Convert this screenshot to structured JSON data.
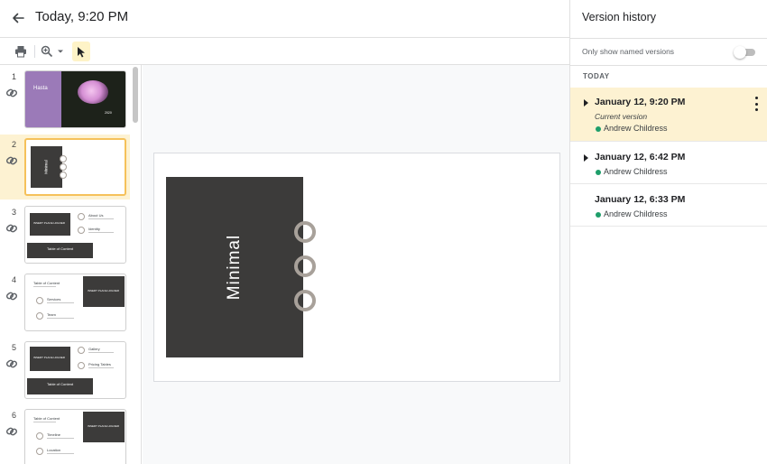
{
  "header": {
    "title": "Today, 9:20 PM"
  },
  "toolbar": {
    "icons": [
      "print-icon",
      "zoom-icon",
      "chevron-down-icon",
      "cursor-icon"
    ]
  },
  "filmstrip": {
    "slides": [
      {
        "number": "1",
        "title": "Hasta",
        "year": "2020"
      },
      {
        "number": "2",
        "title": "Minimal"
      },
      {
        "number": "3",
        "ph": "INSERT PLACE HOLDER",
        "text1": "About Us",
        "text2": "Identity",
        "toc": "Table of Content"
      },
      {
        "number": "4",
        "title": "Table of Content",
        "ph": "INSERT PLACE HOLDER",
        "text1": "Services",
        "text2": "Team"
      },
      {
        "number": "5",
        "ph": "INSERT PLACE HOLDER",
        "text1": "Gallery",
        "text2": "Pricing Tables",
        "toc": "Table of Content"
      },
      {
        "number": "6",
        "title": "Table of Content",
        "ph": "INSERT PLACE HOLDER",
        "text1": "Timeline",
        "text2": "Location"
      }
    ]
  },
  "canvas": {
    "slide_title": "Minimal"
  },
  "version_history": {
    "title": "Version history",
    "toggle_label": "Only show named versions",
    "section": "TODAY",
    "versions": [
      {
        "date": "January 12, 9:20 PM",
        "note": "Current version",
        "author": "Andrew Childress"
      },
      {
        "date": "January 12, 6:42 PM",
        "author": "Andrew Childress"
      },
      {
        "date": "January 12, 6:33 PM",
        "author": "Andrew Childress"
      }
    ]
  },
  "colors": {
    "accent": "#f5c15a",
    "highlight": "#fdf2d2",
    "binder": "#3c3b3a",
    "author_dot": "#1e9e6a"
  }
}
